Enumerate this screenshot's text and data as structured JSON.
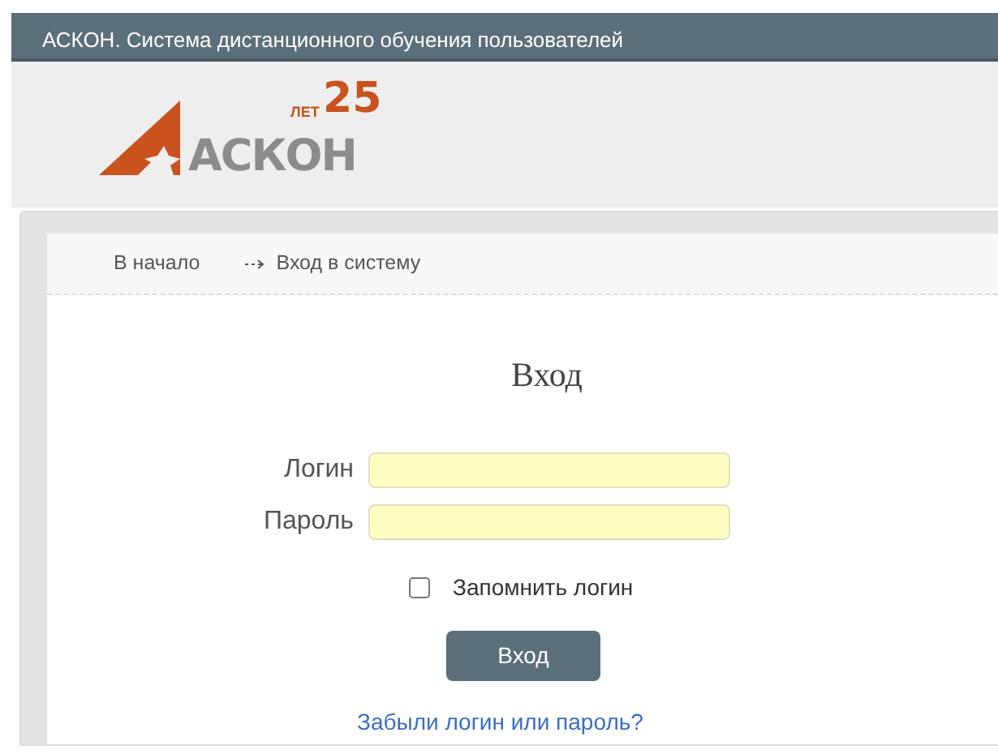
{
  "top_bar": {
    "title": "АСКОН. Система дистанционного обучения пользователей"
  },
  "logo": {
    "number": "25",
    "years": "ЛЕТ",
    "wordmark": "АСКОН"
  },
  "breadcrumbs": [
    {
      "label": "В начало"
    },
    {
      "label": "Вход в систему"
    }
  ],
  "login_form": {
    "title": "Вход",
    "fields": [
      {
        "label": "Логин"
      },
      {
        "label": "Пароль"
      }
    ],
    "remember": {
      "label": "Запомнить логин",
      "checked": false
    },
    "submit": "Вход",
    "forgot_link": "Забыли логин или пароль?"
  }
}
